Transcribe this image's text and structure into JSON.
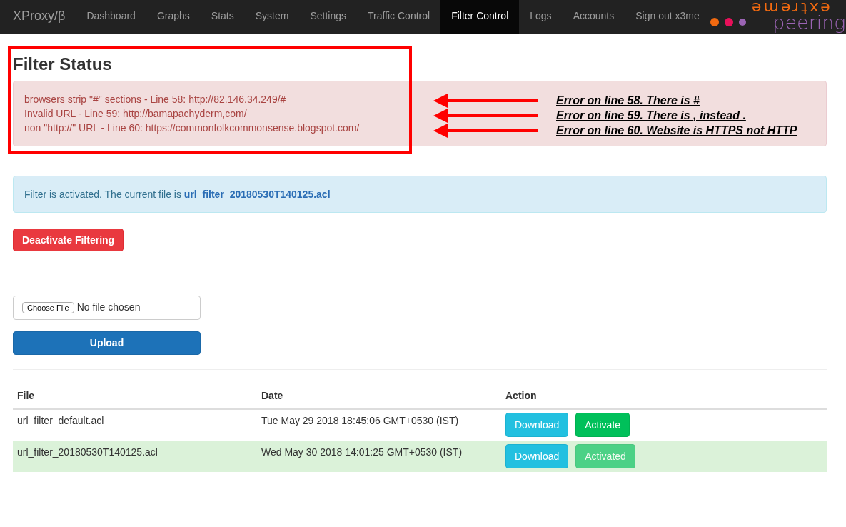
{
  "navbar": {
    "brand": "XProxy/β",
    "items": [
      {
        "label": "Dashboard",
        "selected": false
      },
      {
        "label": "Graphs",
        "selected": false
      },
      {
        "label": "Stats",
        "selected": false
      },
      {
        "label": "System",
        "selected": false
      },
      {
        "label": "Settings",
        "selected": false
      },
      {
        "label": "Traffic Control",
        "selected": false
      },
      {
        "label": "Filter Control",
        "selected": true
      },
      {
        "label": "Logs",
        "selected": false
      },
      {
        "label": "Accounts",
        "selected": false
      },
      {
        "label": "Sign out x3me",
        "selected": false
      }
    ],
    "logo": {
      "top": "extreme",
      "bottom": "peering"
    }
  },
  "title": "Filter Status",
  "errors": [
    "browsers strip \"#\" sections - Line 58: http://82.146.34.249/#",
    "Invalid URL - Line 59: http://bamapachyderm,com/",
    "non \"http://\" URL - Line 60: https://commonfolkcommonsense.blogspot.com/"
  ],
  "annotation_notes": [
    "Error on line 58. There is #",
    "Error on line 59. There is , instead .",
    "Error on line 60. Website is HTTPS not HTTP"
  ],
  "status_alert": {
    "text": "Filter is activated. The current file is",
    "file_link": "url_filter_20180530T140125.acl"
  },
  "deactivate_button": "Deactivate Filtering",
  "upload": {
    "choose_button": "Choose File",
    "file_status": "No file chosen",
    "submit": "Upload"
  },
  "table": {
    "columns": [
      "File",
      "Date",
      "Action"
    ],
    "rows": [
      {
        "file": "url_filter_default.acl",
        "date": "Tue May 29 2018 18:45:06 GMT+0530 (IST)",
        "active": false,
        "actions": [
          {
            "kind": "download",
            "label": "Download",
            "disabled": false
          },
          {
            "kind": "activate",
            "label": "Activate",
            "disabled": false
          }
        ]
      },
      {
        "file": "url_filter_20180530T140125.acl",
        "date": "Wed May 30 2018 14:01:25 GMT+0530 (IST)",
        "active": true,
        "actions": [
          {
            "kind": "download",
            "label": "Download",
            "disabled": false
          },
          {
            "kind": "activate",
            "label": "Activated",
            "disabled": true
          }
        ]
      }
    ]
  }
}
